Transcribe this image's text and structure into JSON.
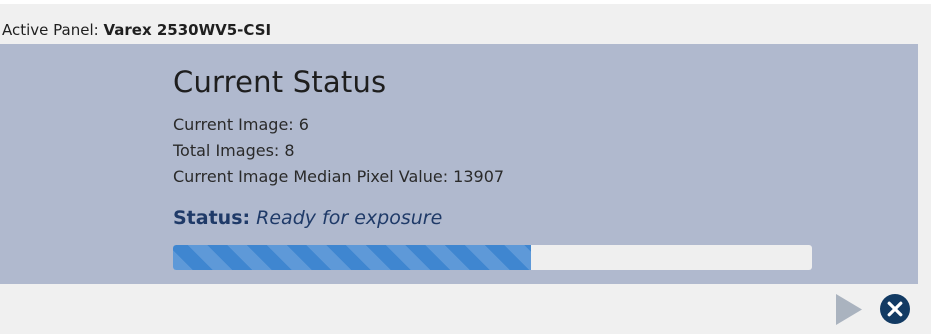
{
  "header": {
    "active_panel_label": "Active Panel:",
    "active_panel_value": "Varex 2530WV5-CSI"
  },
  "status_panel": {
    "title": "Current Status",
    "current_image": "Current Image: 6",
    "total_images": "Total Images: 8",
    "median_pixel": "Current Image Median Pixel Value: 13907",
    "status_label": "Status:",
    "status_value": "Ready for exposure",
    "progress_fraction": 0.56
  },
  "footer": {
    "play_icon": "play-icon",
    "close_icon": "close-circle-icon"
  },
  "colors": {
    "page_background": "#f0f0f0",
    "panel_background": "#b0b9ce",
    "progress_fill": "#3f86d0",
    "progress_track": "#efefef",
    "status_text": "#1f3a68",
    "play_icon": "#aab3bf",
    "close_icon": "#123a63"
  }
}
